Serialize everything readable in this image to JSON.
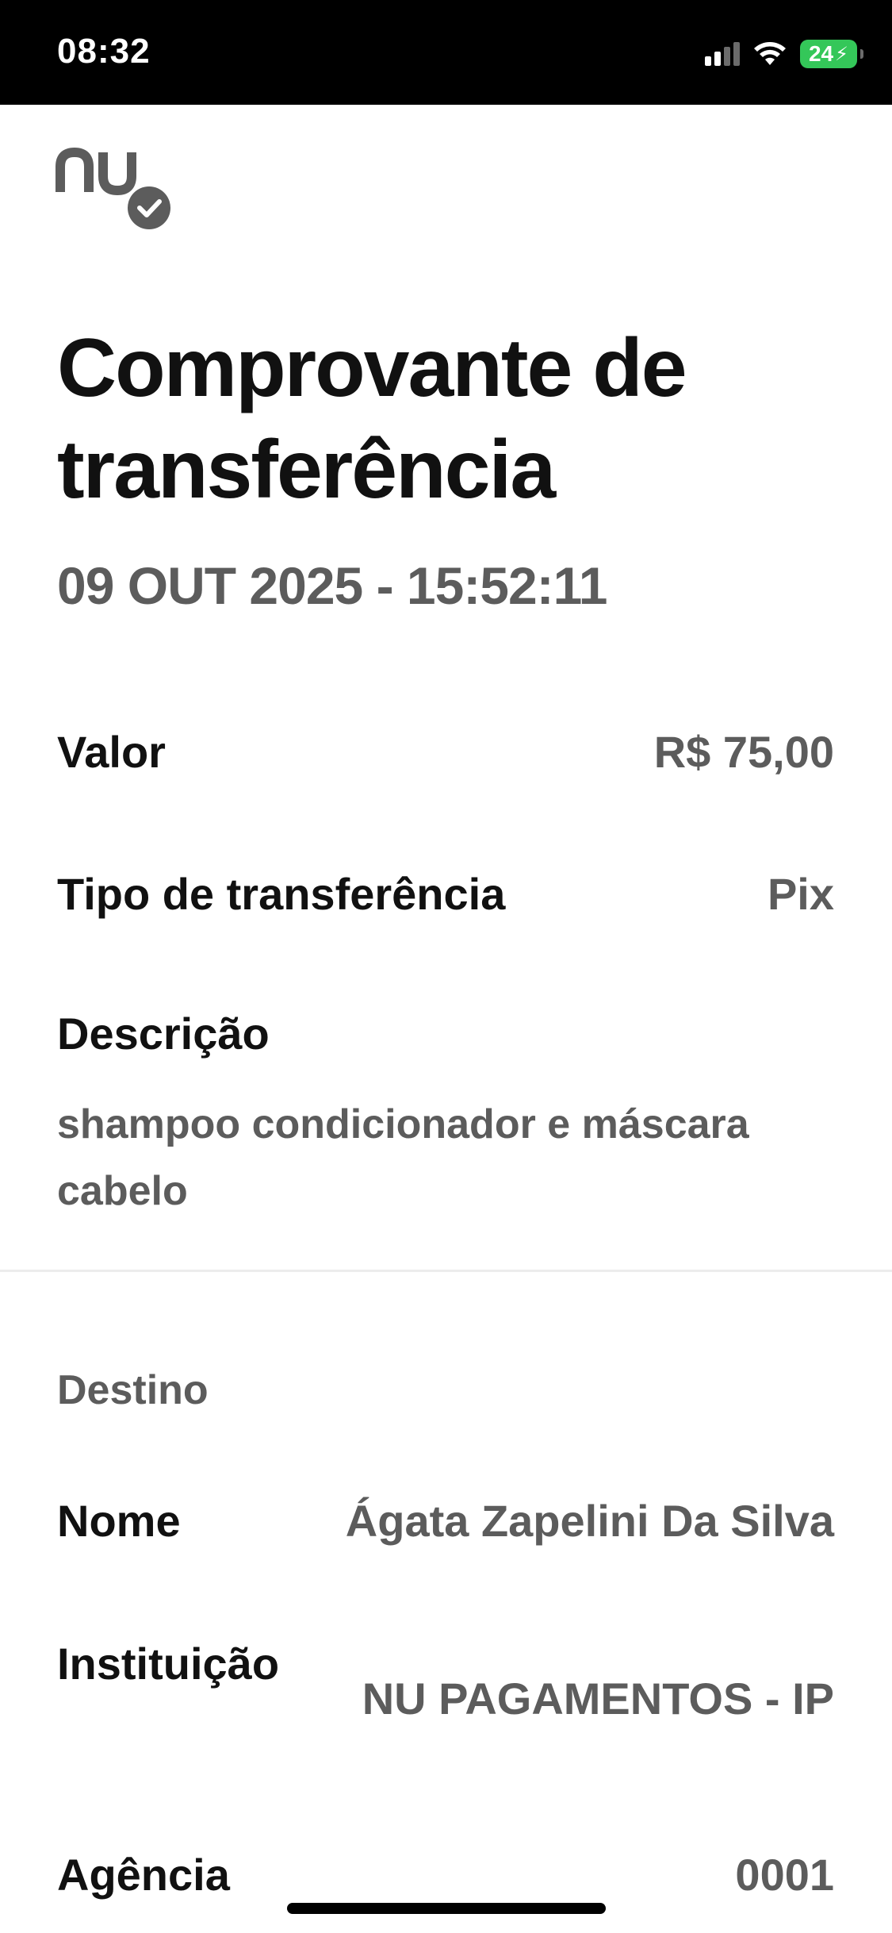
{
  "status_bar": {
    "time": "08:32",
    "battery_level": "24",
    "icons": [
      "signal-icon",
      "wifi-icon",
      "battery-icon"
    ]
  },
  "logo": {
    "icon": "nu-logo-verified-icon",
    "text": "nu"
  },
  "header": {
    "title": "Comprovante de transferência",
    "datetime": "09 OUT 2025 - 15:52:11"
  },
  "details": {
    "valor_label": "Valor",
    "valor_value": "R$ 75,00",
    "tipo_label": "Tipo de transferência",
    "tipo_value": "Pix",
    "descricao_label": "Descrição",
    "descricao_value": "shampoo condicionador e máscara cabelo"
  },
  "destino": {
    "section_title": "Destino",
    "nome_label": "Nome",
    "nome_value": "Ágata Zapelini Da Silva",
    "instituicao_label": "Instituição",
    "instituicao_value": "NU PAGAMENTOS - IP",
    "agencia_label": "Agência",
    "agencia_value": "0001"
  },
  "colors": {
    "primary_text": "#111111",
    "secondary_text": "#5c5c5c",
    "logo": "#5c5c5c",
    "battery": "#34c759"
  }
}
